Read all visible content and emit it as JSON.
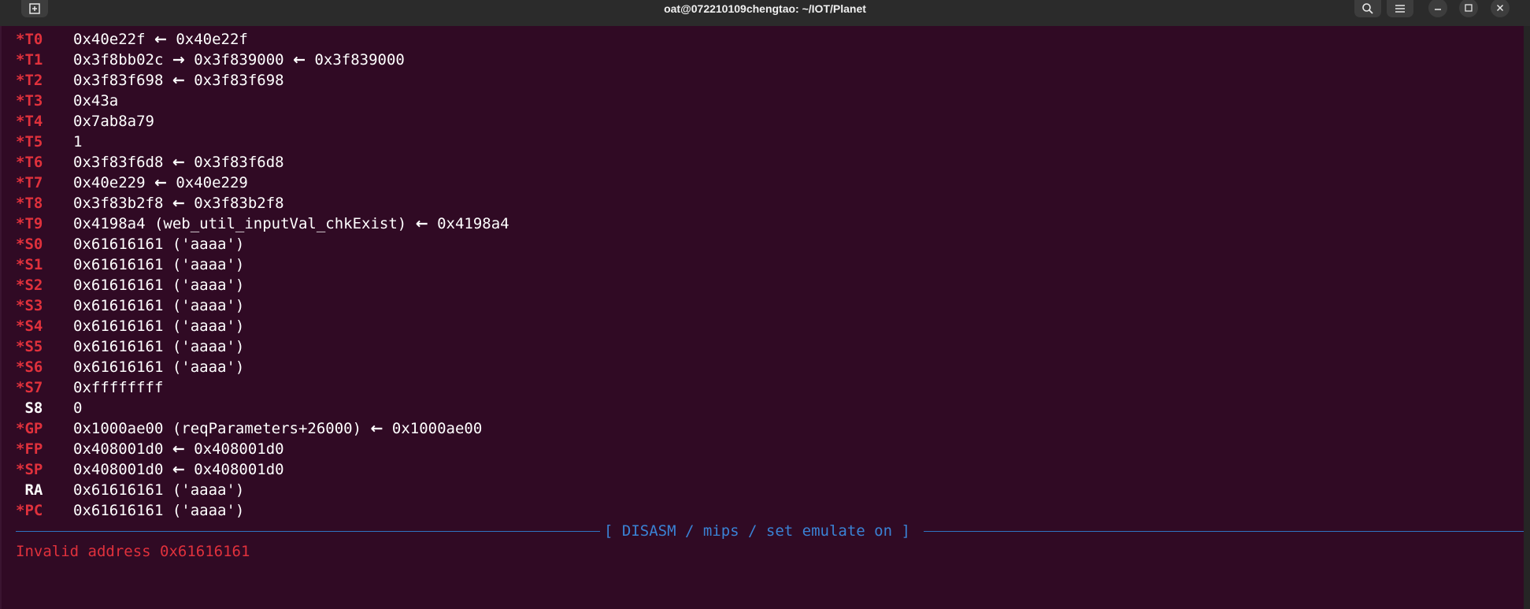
{
  "window": {
    "title": "oat@072210109chengtao: ~/IOT/Planet"
  },
  "icons": {
    "new_tab": "new-tab-icon",
    "search": "search-icon",
    "menu": "hamburger-menu-icon",
    "minimize": "minimize-icon",
    "maximize": "maximize-icon",
    "close": "close-icon"
  },
  "colors": {
    "terminal_bg": "#300a24",
    "changed_register": "#e0313c",
    "separator": "#2f74c0",
    "error": "#e0313c"
  },
  "registers": [
    {
      "name": "*T0",
      "changed": true,
      "parts": [
        "0x40e22f",
        "←",
        "0x40e22f"
      ]
    },
    {
      "name": "*T1",
      "changed": true,
      "parts": [
        "0x3f8bb02c",
        "→",
        "0x3f839000",
        "←",
        "0x3f839000"
      ]
    },
    {
      "name": "*T2",
      "changed": true,
      "parts": [
        "0x3f83f698",
        "←",
        "0x3f83f698"
      ]
    },
    {
      "name": "*T3",
      "changed": true,
      "parts": [
        "0x43a"
      ]
    },
    {
      "name": "*T4",
      "changed": true,
      "parts": [
        "0x7ab8a79"
      ]
    },
    {
      "name": "*T5",
      "changed": true,
      "parts": [
        "1"
      ]
    },
    {
      "name": "*T6",
      "changed": true,
      "parts": [
        "0x3f83f6d8",
        "←",
        "0x3f83f6d8"
      ]
    },
    {
      "name": "*T7",
      "changed": true,
      "parts": [
        "0x40e229",
        "←",
        "0x40e229"
      ]
    },
    {
      "name": "*T8",
      "changed": true,
      "parts": [
        "0x3f83b2f8",
        "←",
        "0x3f83b2f8"
      ]
    },
    {
      "name": "*T9",
      "changed": true,
      "parts": [
        "0x4198a4 (web_util_inputVal_chkExist)",
        "←",
        "0x4198a4"
      ]
    },
    {
      "name": "*S0",
      "changed": true,
      "parts": [
        "0x61616161 ('aaaa')"
      ]
    },
    {
      "name": "*S1",
      "changed": true,
      "parts": [
        "0x61616161 ('aaaa')"
      ]
    },
    {
      "name": "*S2",
      "changed": true,
      "parts": [
        "0x61616161 ('aaaa')"
      ]
    },
    {
      "name": "*S3",
      "changed": true,
      "parts": [
        "0x61616161 ('aaaa')"
      ]
    },
    {
      "name": "*S4",
      "changed": true,
      "parts": [
        "0x61616161 ('aaaa')"
      ]
    },
    {
      "name": "*S5",
      "changed": true,
      "parts": [
        "0x61616161 ('aaaa')"
      ]
    },
    {
      "name": "*S6",
      "changed": true,
      "parts": [
        "0x61616161 ('aaaa')"
      ]
    },
    {
      "name": "*S7",
      "changed": true,
      "parts": [
        "0xffffffff"
      ]
    },
    {
      "name": " S8",
      "changed": false,
      "parts": [
        "0"
      ]
    },
    {
      "name": "*GP",
      "changed": true,
      "parts": [
        "0x1000ae00 (reqParameters+26000)",
        "←",
        "0x1000ae00"
      ]
    },
    {
      "name": "*FP",
      "changed": true,
      "parts": [
        "0x408001d0",
        "←",
        "0x408001d0"
      ]
    },
    {
      "name": "*SP",
      "changed": true,
      "parts": [
        "0x408001d0",
        "←",
        "0x408001d0"
      ]
    },
    {
      "name": " RA",
      "changed": false,
      "parts": [
        "0x61616161 ('aaaa')"
      ]
    },
    {
      "name": "*PC",
      "changed": true,
      "parts": [
        "0x61616161 ('aaaa')"
      ]
    }
  ],
  "disasm_header": "[ DISASM / mips / set emulate on ]",
  "error_message": "Invalid address 0x61616161"
}
